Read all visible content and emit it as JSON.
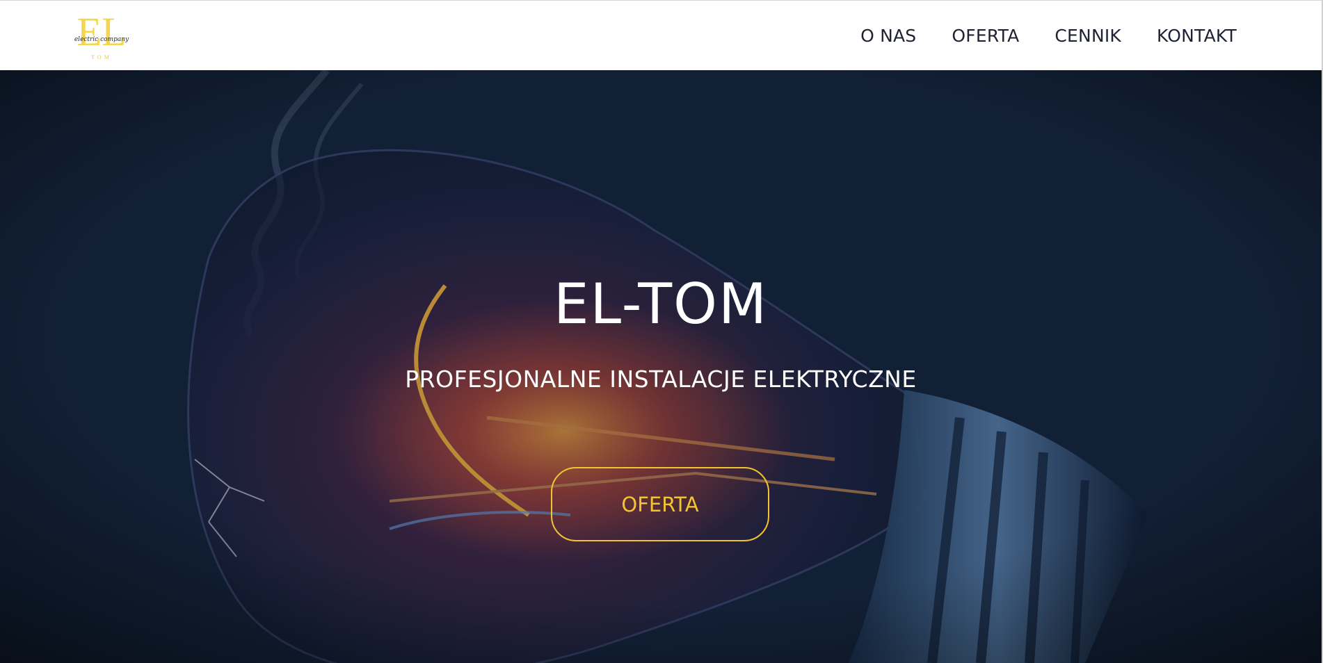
{
  "colors": {
    "accent": "#f2c530",
    "nav_text": "#1f2233",
    "hero_text": "#ffffff",
    "hero_background": "#15263e"
  },
  "header": {
    "logo": {
      "icon": "el-tom-logo",
      "monogram": "EL",
      "script": "electric company",
      "bottom": "TOM"
    },
    "nav": [
      {
        "label": "O NAS"
      },
      {
        "label": "OFERTA"
      },
      {
        "label": "CENNIK"
      },
      {
        "label": "KONTAKT"
      }
    ]
  },
  "hero": {
    "background_image": "broken-light-bulb-image",
    "title": "EL-TOM",
    "subtitle": "PROFESJONALNE INSTALACJE ELEKTRYCZNE",
    "button_label": "OFERTA"
  }
}
